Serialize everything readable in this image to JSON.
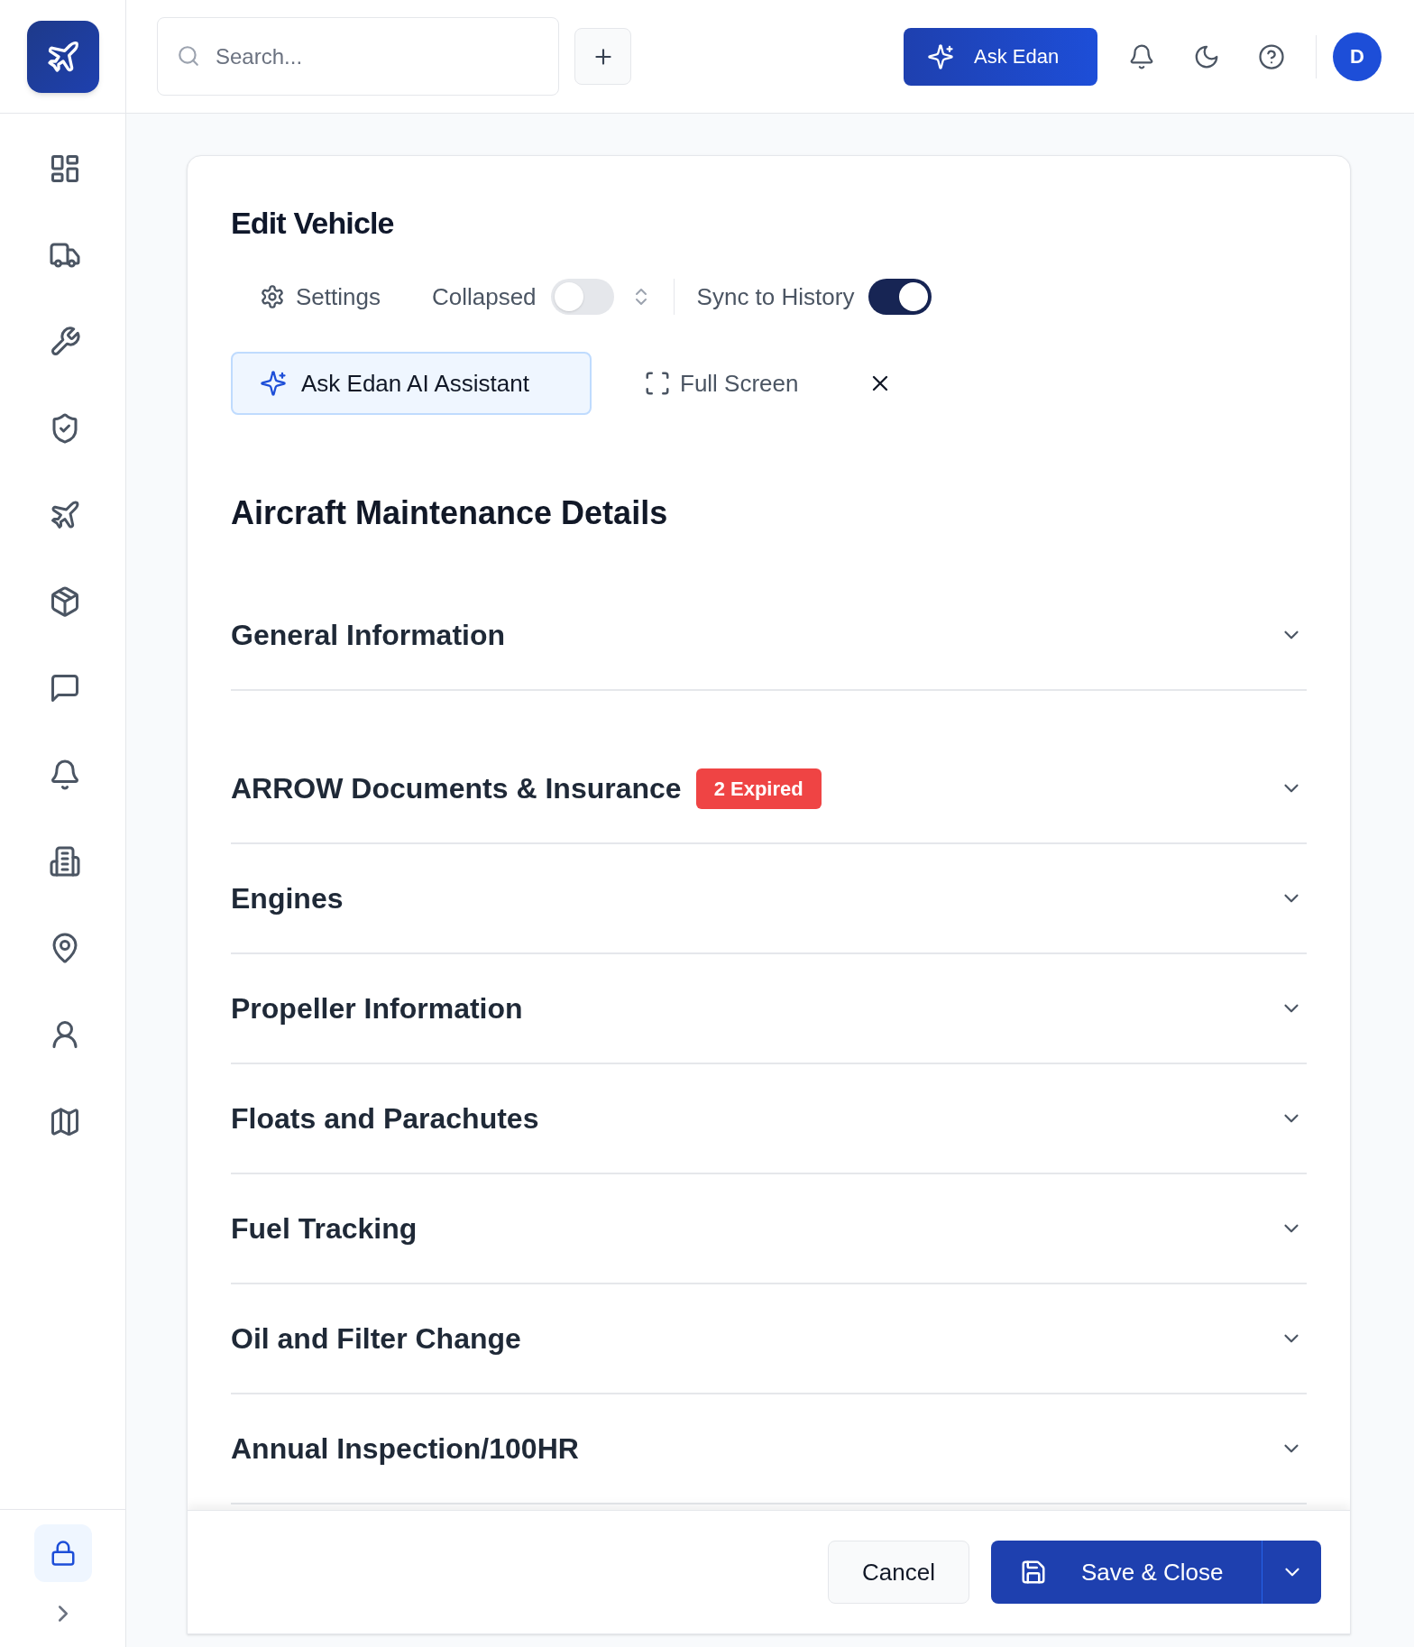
{
  "search": {
    "placeholder": "Search..."
  },
  "top_actions": {
    "ask_button": "Ask Edan",
    "avatar": "D"
  },
  "sidebar": {
    "items": [
      {
        "kind": "grid"
      },
      {
        "kind": "truck"
      },
      {
        "kind": "wrench"
      },
      {
        "kind": "shield"
      },
      {
        "kind": "plane"
      },
      {
        "kind": "box"
      },
      {
        "kind": "chat"
      },
      {
        "kind": "bell"
      },
      {
        "kind": "building"
      },
      {
        "kind": "pin"
      },
      {
        "kind": "user"
      },
      {
        "kind": "map"
      }
    ]
  },
  "dialog": {
    "title": "Edit Vehicle",
    "settings": "Settings",
    "toggles": [
      {
        "label": "Collapsed",
        "on": false
      },
      {
        "label": "Sync to History",
        "on": true
      }
    ],
    "ai_button": "Ask Edan AI Assistant",
    "full_screen": "Full Screen"
  },
  "form": {
    "title": "Aircraft Maintenance Details",
    "sections": [
      {
        "title": "General Information",
        "expanded": false
      },
      {
        "title": "ARROW Documents & Insurance",
        "badge": "2 Expired",
        "expanded": false
      },
      {
        "title": "Engines",
        "expanded": false
      },
      {
        "title": "Propeller Information",
        "expanded": false
      },
      {
        "title": "Floats and Parachutes",
        "expanded": false
      },
      {
        "title": "Fuel Tracking",
        "expanded": false
      },
      {
        "title": "Oil and Filter Change",
        "expanded": false
      },
      {
        "title": "Annual Inspection/100HR",
        "expanded": false
      }
    ]
  },
  "footer": {
    "cancel": "Cancel",
    "save": "Save & Close"
  }
}
